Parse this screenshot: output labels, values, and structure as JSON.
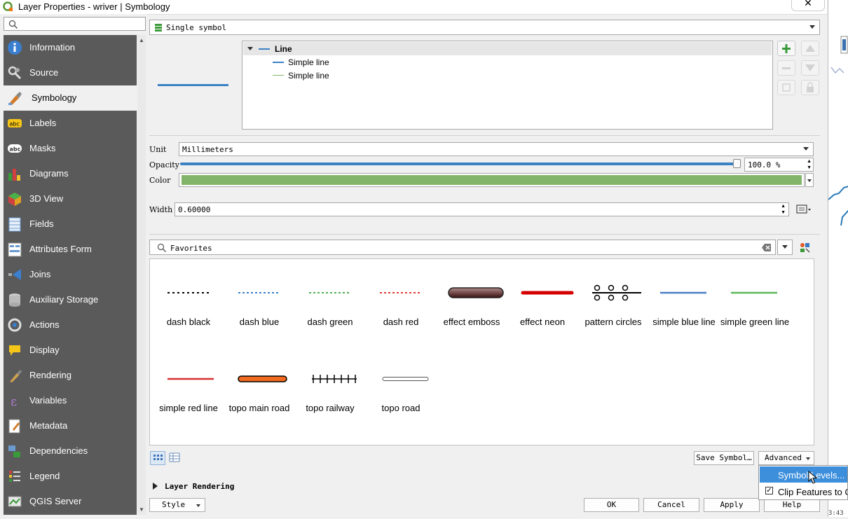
{
  "window": {
    "title": "Layer Properties - wriver | Symbology",
    "close_icon": "✕"
  },
  "sidebar": {
    "items": [
      {
        "label": "Information",
        "icon": "information-icon"
      },
      {
        "label": "Source",
        "icon": "source-icon"
      },
      {
        "label": "Symbology",
        "icon": "symbology-icon",
        "selected": true
      },
      {
        "label": "Labels",
        "icon": "labels-icon"
      },
      {
        "label": "Masks",
        "icon": "masks-icon"
      },
      {
        "label": "Diagrams",
        "icon": "diagrams-icon"
      },
      {
        "label": "3D View",
        "icon": "3d-view-icon"
      },
      {
        "label": "Fields",
        "icon": "fields-icon"
      },
      {
        "label": "Attributes Form",
        "icon": "attributes-form-icon"
      },
      {
        "label": "Joins",
        "icon": "joins-icon"
      },
      {
        "label": "Auxiliary Storage",
        "icon": "auxiliary-storage-icon"
      },
      {
        "label": "Actions",
        "icon": "actions-icon"
      },
      {
        "label": "Display",
        "icon": "display-icon"
      },
      {
        "label": "Rendering",
        "icon": "rendering-icon"
      },
      {
        "label": "Variables",
        "icon": "variables-icon"
      },
      {
        "label": "Metadata",
        "icon": "metadata-icon"
      },
      {
        "label": "Dependencies",
        "icon": "dependencies-icon"
      },
      {
        "label": "Legend",
        "icon": "legend-icon"
      },
      {
        "label": "QGIS Server",
        "icon": "qgis-server-icon"
      }
    ]
  },
  "renderer": {
    "selected": "Single symbol"
  },
  "symbol_tree": {
    "root": "Line",
    "layers": [
      "Simple line",
      "Simple line"
    ]
  },
  "properties": {
    "unit_label": "Unit",
    "unit_value": "Millimeters",
    "opacity_label": "Opacity",
    "opacity_value": "100.0 %",
    "opacity_fraction": 1.0,
    "color_label": "Color",
    "color_value": "#82b56a",
    "width_label": "Width",
    "width_value": "0.60000"
  },
  "library": {
    "search_value": "Favorites",
    "symbols": [
      {
        "name": "dash  black",
        "style": "dash-black"
      },
      {
        "name": "dash blue",
        "style": "dash-blue"
      },
      {
        "name": "dash green",
        "style": "dash-green"
      },
      {
        "name": "dash red",
        "style": "dash-red"
      },
      {
        "name": "effect emboss",
        "style": "emboss"
      },
      {
        "name": "effect neon",
        "style": "neon"
      },
      {
        "name": "pattern circles",
        "style": "circles"
      },
      {
        "name": "simple blue line",
        "style": "blue-line"
      },
      {
        "name": "simple green line",
        "style": "green-line"
      },
      {
        "name": "simple red line",
        "style": "red-line"
      },
      {
        "name": "topo main road",
        "style": "main-road"
      },
      {
        "name": "topo railway",
        "style": "railway"
      },
      {
        "name": "topo road",
        "style": "road"
      }
    ]
  },
  "buttons": {
    "save_symbol": "Save Symbol…",
    "advanced": "Advanced",
    "style": "Style",
    "ok": "OK",
    "cancel": "Cancel",
    "apply": "Apply",
    "help": "Help"
  },
  "layer_rendering": "Layer Rendering",
  "advanced_menu": {
    "items": [
      "Symbol Levels...",
      "Clip Features to C"
    ]
  },
  "colors": {
    "accent_blue": "#3b82c4",
    "sidebar_bg": "#5a5a5a",
    "menu_highlight": "#3d8fdc"
  }
}
